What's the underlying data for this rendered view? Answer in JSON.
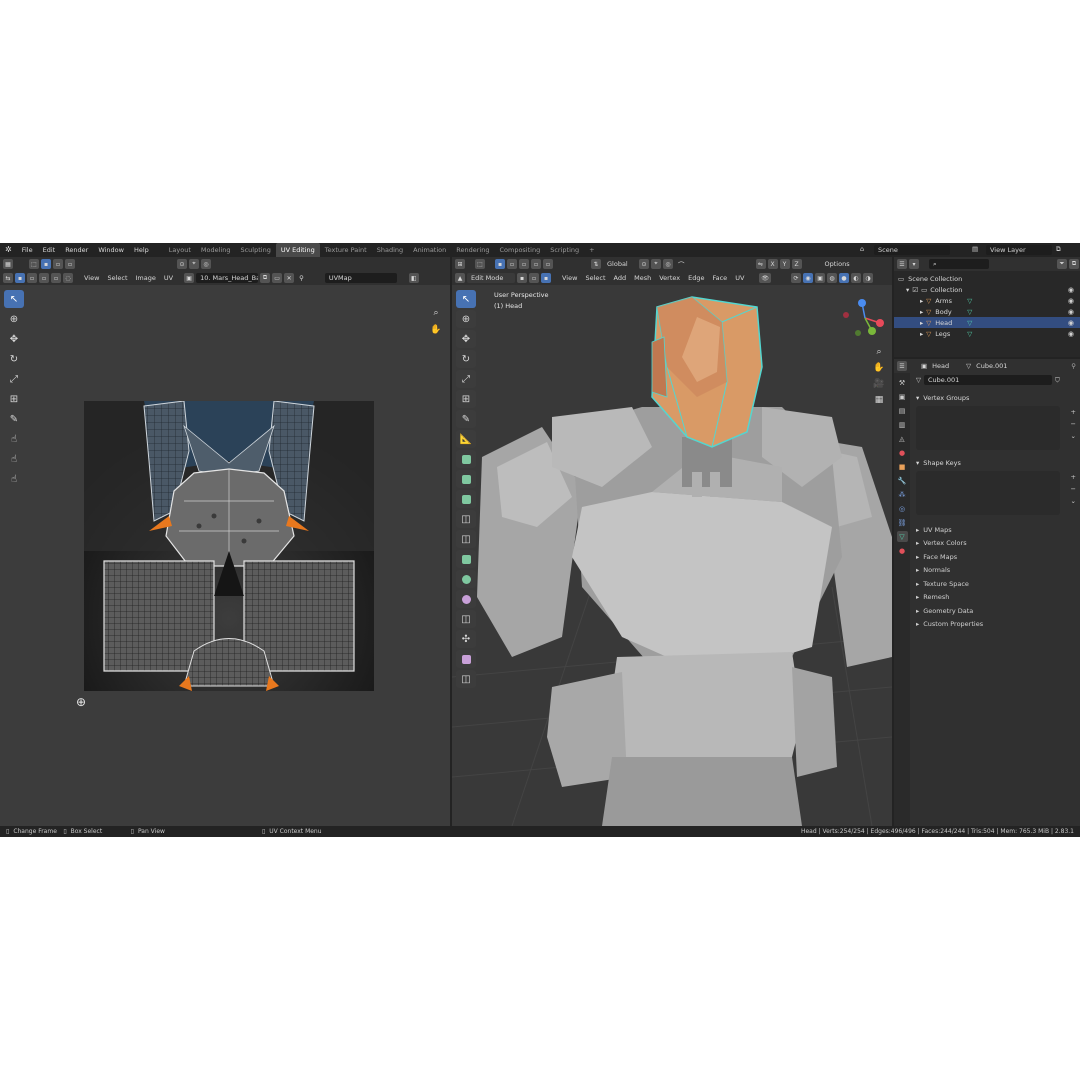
{
  "topbar": {
    "menu": [
      "File",
      "Edit",
      "Render",
      "Window",
      "Help"
    ],
    "workspaces": [
      "Layout",
      "Modeling",
      "Sculpting",
      "UV Editing",
      "Texture Paint",
      "Shading",
      "Animation",
      "Rendering",
      "Compositing",
      "Scripting"
    ],
    "active_workspace": "UV Editing",
    "add_tab": "+",
    "scene": "Scene",
    "view_layer": "View Layer"
  },
  "uv_editor": {
    "menus": [
      "View",
      "Select",
      "Image",
      "UV"
    ],
    "image_name": "10. Mars_Head_Bas...",
    "uv_map": "UVMap"
  },
  "viewport": {
    "mode": "Edit Mode",
    "menus": [
      "View",
      "Select",
      "Add",
      "Mesh",
      "Vertex",
      "Edge",
      "Face",
      "UV"
    ],
    "orientation": "Global",
    "options_label": "Options",
    "axes": [
      "X",
      "Y",
      "Z"
    ],
    "overlay_title": "User Perspective",
    "overlay_object": "(1) Head"
  },
  "outliner": {
    "root": "Scene Collection",
    "collection": "Collection",
    "items": [
      {
        "label": "Arms",
        "selected": false
      },
      {
        "label": "Body",
        "selected": false
      },
      {
        "label": "Head",
        "selected": true
      },
      {
        "label": "Legs",
        "selected": false
      }
    ]
  },
  "properties": {
    "object_name": "Head",
    "mesh_name": "Cube.001",
    "datablock": "Cube.001",
    "open_panels": [
      "Vertex Groups",
      "Shape Keys"
    ],
    "closed_panels": [
      "UV Maps",
      "Vertex Colors",
      "Face Maps",
      "Normals",
      "Texture Space",
      "Remesh",
      "Geometry Data",
      "Custom Properties"
    ]
  },
  "status": {
    "hint1": "Change Frame",
    "hint2": "Box Select",
    "hint3": "Pan View",
    "hint4": "UV Context Menu",
    "stats": "Head | Verts:254/254 | Edges:496/496 | Faces:244/244 | Tris:504 | Mem: 765.3 MiB | 2.83.1"
  },
  "colors": {
    "accent": "#4772b3",
    "selected_row": "#334d80",
    "mesh_select": "#e8a05a",
    "edge_highlight": "#54d6d0"
  }
}
